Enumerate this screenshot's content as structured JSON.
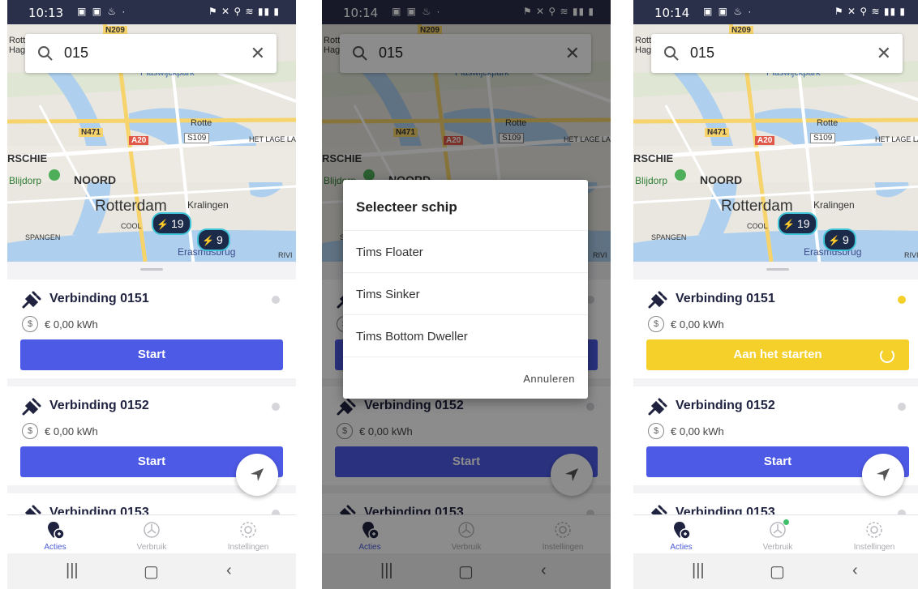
{
  "status_times": [
    "10:13",
    "10:14",
    "10:14"
  ],
  "search": {
    "query": "015"
  },
  "map_labels": {
    "n209": "N209",
    "n471": "N471",
    "a20": "A20",
    "s109": "S109",
    "rotte": "Rotte",
    "rott_hag": "Rott Hag",
    "schie": "RSCHIE",
    "blijdorp": "Blijdorp",
    "noord": "NOORD",
    "rotterdam": "Rotterdam",
    "kralingen": "Kralingen",
    "cool": "COOL",
    "spangen": "SPANGEN",
    "het_lage_land": "HET LAGE LA",
    "erasmusbrug": "Erasmusbrug",
    "plaswijckpark": "Plaswijckpark",
    "rivi": "RIVI"
  },
  "pins": [
    {
      "count": "19"
    },
    {
      "count": "9"
    }
  ],
  "connections": [
    {
      "name": "Verbinding 0151",
      "price": "€ 0,00 kWh"
    },
    {
      "name": "Verbinding 0152",
      "price": "€ 0,00 kWh"
    },
    {
      "name": "Verbinding 0153"
    }
  ],
  "currency_symbol": "$",
  "start_label": "Start",
  "starting_label": "Aan het starten",
  "status_colors": {
    "idle": "#d6d6da",
    "starting": "#f5cf2a",
    "accent": "#4d5ae6"
  },
  "tabs": [
    {
      "label": "Acties",
      "icon": "plug-location-icon"
    },
    {
      "label": "Verbruik",
      "icon": "gauge-icon"
    },
    {
      "label": "Instellingen",
      "icon": "gear-icon"
    }
  ],
  "dialog": {
    "title": "Selecteer schip",
    "options": [
      "Tims Floater",
      "Tims Sinker",
      "Tims Bottom Dweller"
    ],
    "cancel": "Annuleren"
  }
}
